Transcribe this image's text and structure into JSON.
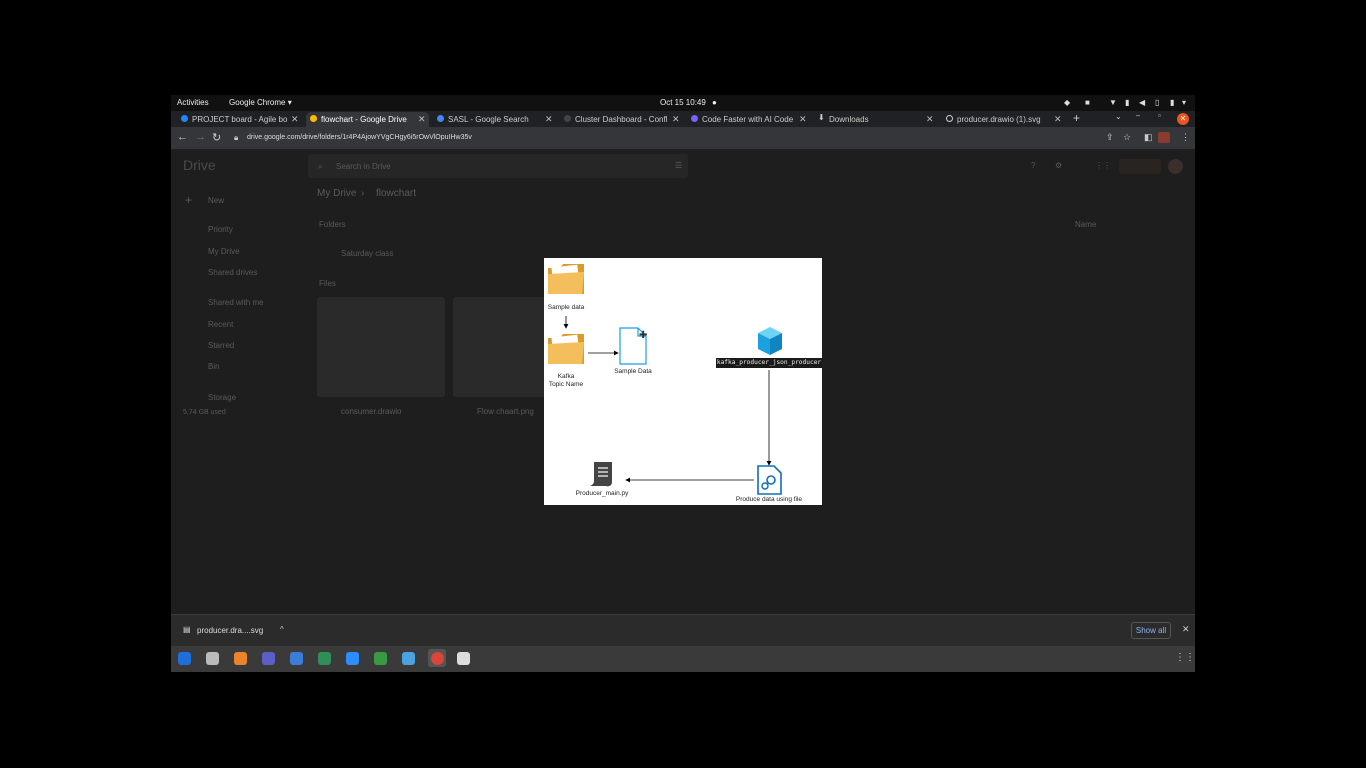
{
  "topbar": {
    "activities": "Activities",
    "app_name": "Google Chrome ▾",
    "clock": "Oct 15  10:49"
  },
  "tabs": [
    {
      "label": "PROJECT board - Agile bo",
      "color": "#2684ff"
    },
    {
      "label": "flowchart - Google Drive",
      "color": "#fbbc04"
    },
    {
      "label": "SASL - Google Search",
      "color": "#4285f4"
    },
    {
      "label": "Cluster Dashboard - Confl",
      "color": "#444444"
    },
    {
      "label": "Code Faster with AI Code",
      "color": "#7b61ff"
    },
    {
      "label": "Downloads",
      "color": "#cccccc"
    },
    {
      "label": "producer.drawio (1).svg",
      "color": "#cccccc"
    }
  ],
  "address": {
    "url": "drive.google.com/drive/folders/1r4P4AjowYVgCHgy6i5rOwVlOpuIHw35v"
  },
  "drive": {
    "logo": "Drive",
    "search_placeholder": "Search in Drive",
    "new_button": "New",
    "nav": [
      "Priority",
      "My Drive",
      "Shared drives",
      "Shared with me",
      "Recent",
      "Starred",
      "Bin",
      "Storage"
    ],
    "storage_used": "5.74 GB used",
    "breadcrumb_root": "My Drive",
    "breadcrumb_current": "flowchart",
    "folders_header": "Folders",
    "folder_name": "Saturday class",
    "files_header": "Files",
    "sort_label": "Name",
    "files": [
      "consumer.drawio",
      "Flow chaart.png"
    ]
  },
  "diagram": {
    "nodes": {
      "sample_data_folder": "Sample data",
      "kafka_topic_line1": "Kafka",
      "kafka_topic_line2": "Topic Name",
      "sample_data_doc": "Sample Data",
      "producer_box": "kafka_producer_json_producer",
      "produce_data": "Produce data using file",
      "producer_main": "Producer_main.py"
    }
  },
  "download": {
    "file": "producer.dra....svg",
    "show_all": "Show all"
  },
  "colors": {
    "accent_blue": "#1ba1e2",
    "folder": "#f0b54d"
  }
}
